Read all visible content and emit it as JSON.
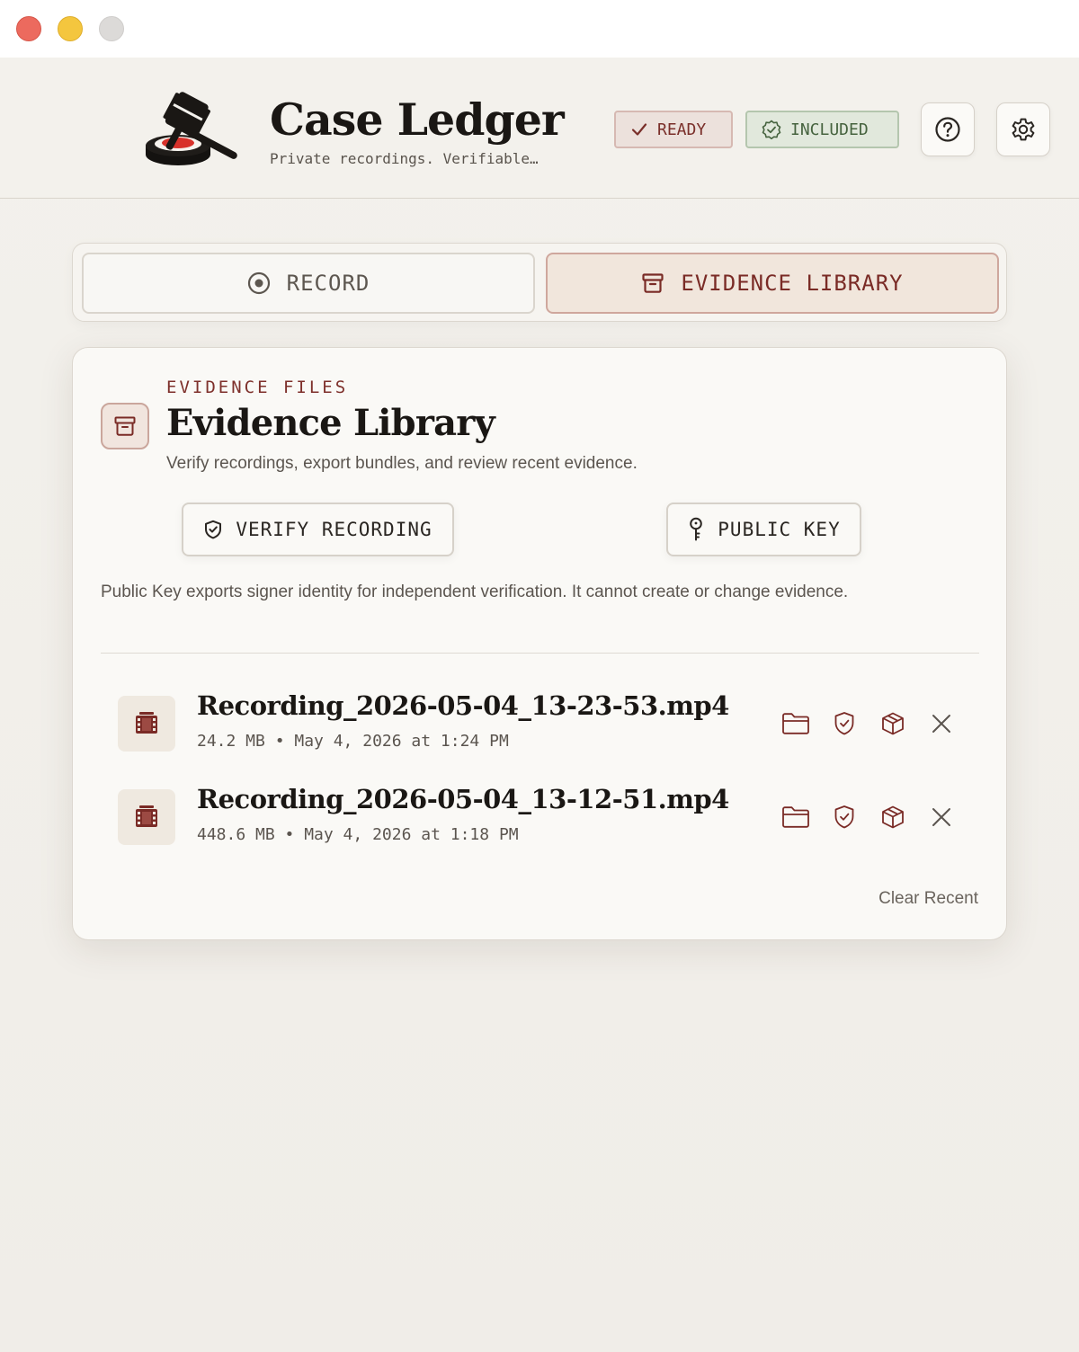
{
  "app": {
    "title": "Case Ledger",
    "subtitle": "Private recordings. Verifiable…",
    "accent": "#7a2b26"
  },
  "header": {
    "status_ready": "READY",
    "status_included": "INCLUDED",
    "help_icon": "question-circle-icon",
    "settings_icon": "gear-icon"
  },
  "tabs": [
    {
      "label": "RECORD",
      "icon": "record-icon",
      "active": false
    },
    {
      "label": "EVIDENCE LIBRARY",
      "icon": "archive-box-icon",
      "active": true
    }
  ],
  "library": {
    "eyebrow": "EVIDENCE FILES",
    "title": "Evidence Library",
    "description": "Verify recordings, export bundles, and review recent evidence.",
    "verify_label": "VERIFY RECORDING",
    "public_key_label": "PUBLIC KEY",
    "note": "Public Key exports signer identity for independent verification. It cannot create or change evidence.",
    "clear_label": "Clear Recent",
    "files": [
      {
        "name": "Recording_2026-05-04_13-23-53.mp4",
        "meta": "24.2 MB • May 4, 2026 at 1:24 PM"
      },
      {
        "name": "Recording_2026-05-04_13-12-51.mp4",
        "meta": "448.6 MB • May 4, 2026 at 1:18 PM"
      }
    ]
  }
}
